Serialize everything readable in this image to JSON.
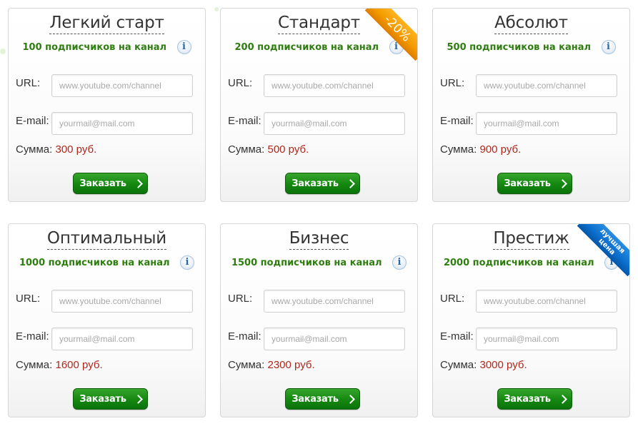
{
  "placeholders": {
    "url": "www.youtube.com/channel",
    "email": "yourmail@mail.com"
  },
  "labels": {
    "url": "URL:",
    "email": "E-mail:",
    "sum": "Сумма:",
    "order": "Заказать"
  },
  "colors": {
    "accent_green": "#2e7d0f",
    "price_red": "#b0271c",
    "button_green": "#168a12",
    "ribbon_orange": "#f39a00",
    "ribbon_blue": "#0b6fcd"
  },
  "icons": {
    "info": "i",
    "arrow": "chevron-right-icon"
  },
  "plans": [
    {
      "title": "Легкий старт",
      "subscribers": "100 подписчиков на канал",
      "price": "300 руб.",
      "ribbon": ""
    },
    {
      "title": "Стандарт",
      "subscribers": "200 подписчиков на канал",
      "price": "500 руб.",
      "ribbon": "-20%"
    },
    {
      "title": "Абсолют",
      "subscribers": "500 подписчиков на канал",
      "price": "900 руб.",
      "ribbon": ""
    },
    {
      "title": "Оптимальный",
      "subscribers": "1000 подписчиков на канал",
      "price": "1600 руб.",
      "ribbon": ""
    },
    {
      "title": "Бизнес",
      "subscribers": "1500 подписчиков на канал",
      "price": "2300 руб.",
      "ribbon": ""
    },
    {
      "title": "Престиж",
      "subscribers": "2000 подписчиков на канал",
      "price": "3000 руб.",
      "ribbon": "лучшая цена",
      "ribbon_line1": "лучшая",
      "ribbon_line2": "цена"
    }
  ]
}
